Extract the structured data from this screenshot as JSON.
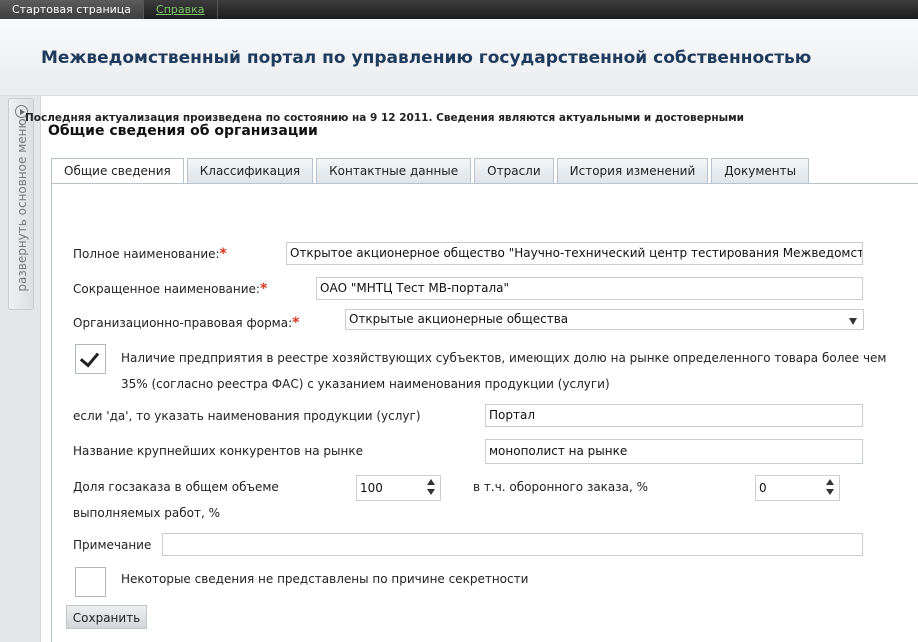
{
  "topnav": {
    "home_label": "Стартовая страница",
    "help_label": "Справка"
  },
  "header": {
    "title": "Межведомственный портал по управлению государственной собственностью"
  },
  "sidemenu": {
    "label": "развернуть основное меню"
  },
  "section": {
    "title": "Общие сведения об организации"
  },
  "tabs": [
    {
      "label": "Общие сведения",
      "active": true
    },
    {
      "label": "Классификация"
    },
    {
      "label": "Контактные данные"
    },
    {
      "label": "Отрасли"
    },
    {
      "label": "История изменений"
    },
    {
      "label": "Документы"
    }
  ],
  "form": {
    "notice": "Последняя актуализация произведена по состоянию на 9 12 2011. Сведения являются актуальными и достоверными",
    "required_mark": "*",
    "full_name_label": "Полное наименование:",
    "full_name_value": "Открытое акционерное общество \"Научно-технический центр тестирования Межведомственного портала\"",
    "short_name_label": "Сокращенное наименование:",
    "short_name_value": "ОАО \"МНТЦ Тест МВ-портала\"",
    "legal_form_label": "Организационно-правовая форма:",
    "legal_form_value": "Открытые акционерные общества",
    "registry_checked": true,
    "registry_label_line1": "Наличие предприятия в реестре хозяйствующих субъектов, имеющих долю на рынке определенного товара более чем",
    "registry_label_line2": "35% (согласно реестра ФАС) с указанием наименования продукции (услуги)",
    "products_label": "если 'да', то указать наименования продукции (услуг)",
    "products_value": "Портал",
    "competitors_label": "Название крупнейших конкурентов на рынке",
    "competitors_value": "монополист на рынке",
    "gov_order_label_line1": "Доля госзаказа в общем объеме",
    "gov_order_label_line2": "выполняемых работ, %",
    "gov_order_value": "100",
    "defense_label": "в т.ч. оборонного заказа, %",
    "defense_value": "0",
    "note_label": "Примечание",
    "note_value": "",
    "secret_checked": false,
    "secret_label": "Некоторые сведения не представлены по причине секретности",
    "save_label": "Сохранить"
  }
}
